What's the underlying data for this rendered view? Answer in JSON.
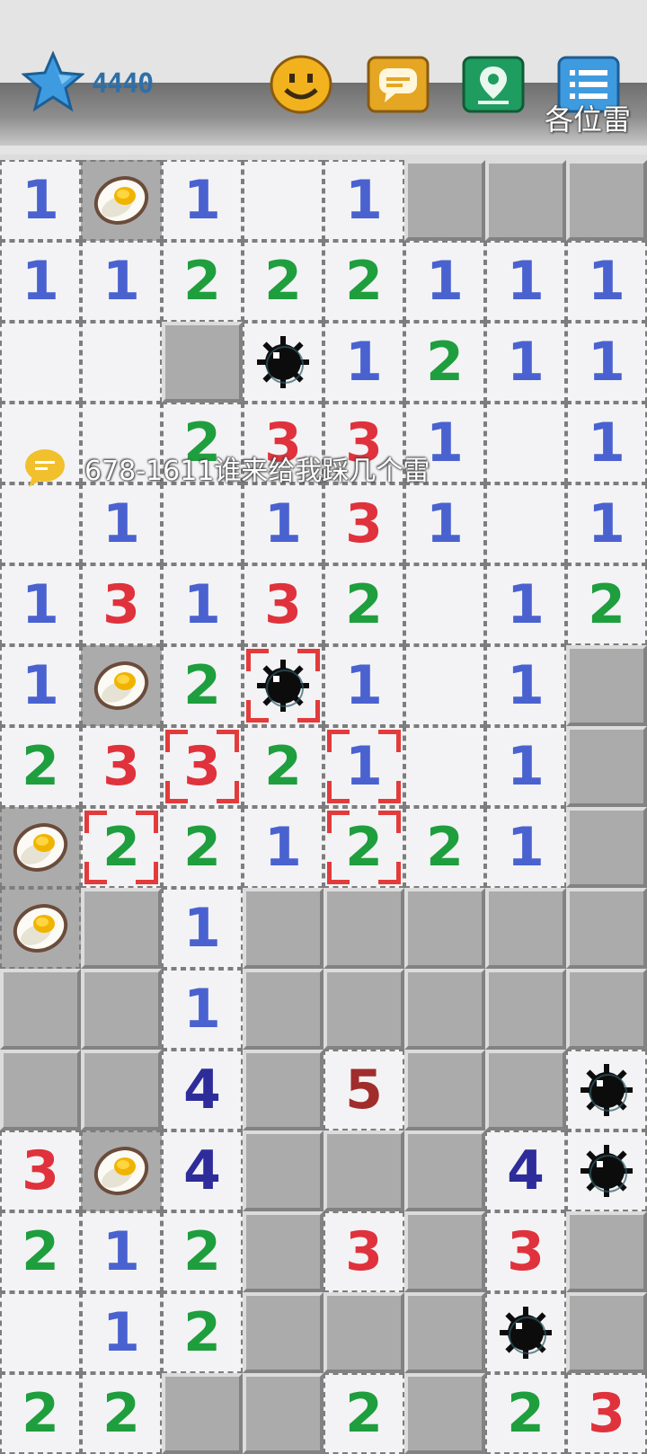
{
  "header": {
    "score": "4440",
    "marquee_text": "各位雷",
    "icons": [
      "star-icon",
      "smiley-icon",
      "chat-icon",
      "location-icon",
      "menu-icon"
    ],
    "colors": {
      "star": "#3f9be0",
      "smiley": "#f2b21e",
      "chat": "#e4a623",
      "location": "#1f9c5f",
      "menu": "#3f9be0"
    }
  },
  "chat_notice": {
    "text": "678-1611谁来给我踩几个雷",
    "icon": "chat-bubble-icon"
  },
  "board": {
    "columns": 8,
    "rows": 16,
    "legend": {
      "H": "hidden",
      "E": "egg-flag",
      "M": "mine",
      "0": "empty",
      "1-5": "number"
    },
    "cells": [
      [
        "1",
        "E",
        "1",
        "0",
        "1",
        "H",
        "H",
        "H"
      ],
      [
        "1",
        "1",
        "2",
        "2",
        "2",
        "1",
        "1",
        "1"
      ],
      [
        "0",
        "0",
        "H",
        "M",
        "1",
        "2",
        "1",
        "1"
      ],
      [
        "0",
        "0",
        "2",
        "3",
        "3",
        "1",
        "0",
        "1"
      ],
      [
        "0",
        "1",
        "0",
        "1",
        "3",
        "1",
        "0",
        "1"
      ],
      [
        "1",
        "3",
        "1",
        "3",
        "2",
        "0",
        "1",
        "2"
      ],
      [
        "1",
        "E",
        "2",
        "M",
        "1",
        "0",
        "1",
        "H"
      ],
      [
        "2",
        "3",
        "3",
        "2",
        "1",
        "0",
        "1",
        "H"
      ],
      [
        "E",
        "2",
        "2",
        "1",
        "2",
        "2",
        "1",
        "H"
      ],
      [
        "E",
        "H",
        "1",
        "H",
        "H",
        "H",
        "H",
        "H"
      ],
      [
        "H",
        "H",
        "1",
        "H",
        "H",
        "H",
        "H",
        "H"
      ],
      [
        "H",
        "H",
        "4",
        "H",
        "5",
        "H",
        "H",
        "M"
      ],
      [
        "3",
        "E",
        "4",
        "H",
        "H",
        "H",
        "4",
        "M"
      ],
      [
        "2",
        "1",
        "2",
        "H",
        "3",
        "H",
        "3",
        "H"
      ],
      [
        "0",
        "1",
        "2",
        "H",
        "H",
        "H",
        "M",
        "H"
      ],
      [
        "2",
        "2",
        "H",
        "H",
        "2",
        "H",
        "2",
        "3"
      ]
    ],
    "highlighted": [
      [
        6,
        3
      ],
      [
        7,
        2
      ],
      [
        7,
        4
      ],
      [
        8,
        1
      ],
      [
        8,
        4
      ]
    ],
    "number_colors": {
      "1": "#4a62d0",
      "2": "#1f9e3e",
      "3": "#e0323c",
      "4": "#2d2c9a",
      "5": "#a12c2c"
    }
  }
}
